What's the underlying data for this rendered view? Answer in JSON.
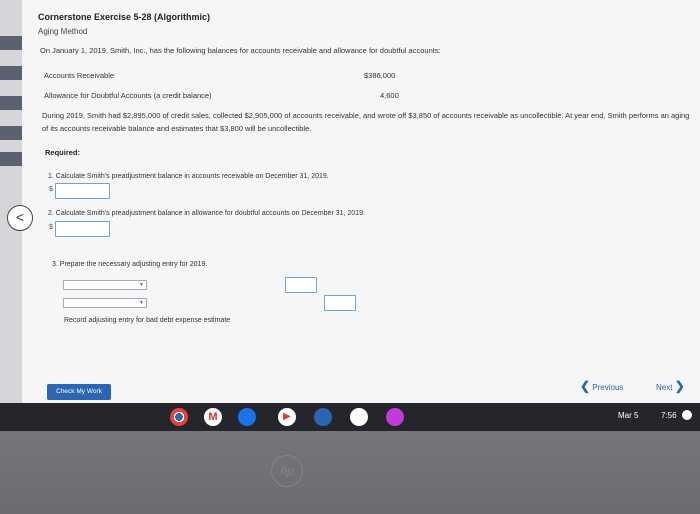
{
  "exercise": {
    "title": "Cornerstone Exercise 5-28 (Algorithmic)",
    "subtitle": "Aging Method",
    "intro": "On January 1, 2019, Smith, Inc., has the following balances for accounts receivable and allowance for doubtful accounts:",
    "balances": [
      {
        "label": "Accounts Receivable",
        "value": "$386,000"
      },
      {
        "label": "Allowance for Doubtful Accounts (a credit balance)",
        "value": "4,600"
      }
    ],
    "paragraph": "During 2019, Smith had $2,895,000 of credit sales, collected $2,905,000 of accounts receivable, and wrote off $3,850 of accounts receivable as uncollectible. At year end, Smith performs an aging of its accounts receivable balance and estimates that $3,800 will be uncollectible.",
    "required_label": "Required:",
    "q1": "1.  Calculate Smith's preadjustment balance in accounts receivable on December 31, 2019.",
    "q2": "2.  Calculate Smith's preadjustment balance in allowance for doubtful accounts on December 31, 2019.",
    "q3": "3.  Prepare the necessary adjusting entry for 2019.",
    "currency_symbol": "$",
    "entry_note": "Record adjusting entry for bad debt expense estimate"
  },
  "footer": {
    "check_button": "Check My Work",
    "previous_label": "Previous",
    "next_label": "Next"
  },
  "shelf": {
    "apps": [
      "chrome-icon",
      "gmail-icon",
      "docs-icon",
      "youtube-icon",
      "meet-icon",
      "photos-icon",
      "app-icon"
    ],
    "date": "Mar 5",
    "time": "7:56"
  },
  "colors": {
    "accent": "#2a66b3",
    "input_border": "#6da6cf",
    "shelf": "#25262b"
  }
}
